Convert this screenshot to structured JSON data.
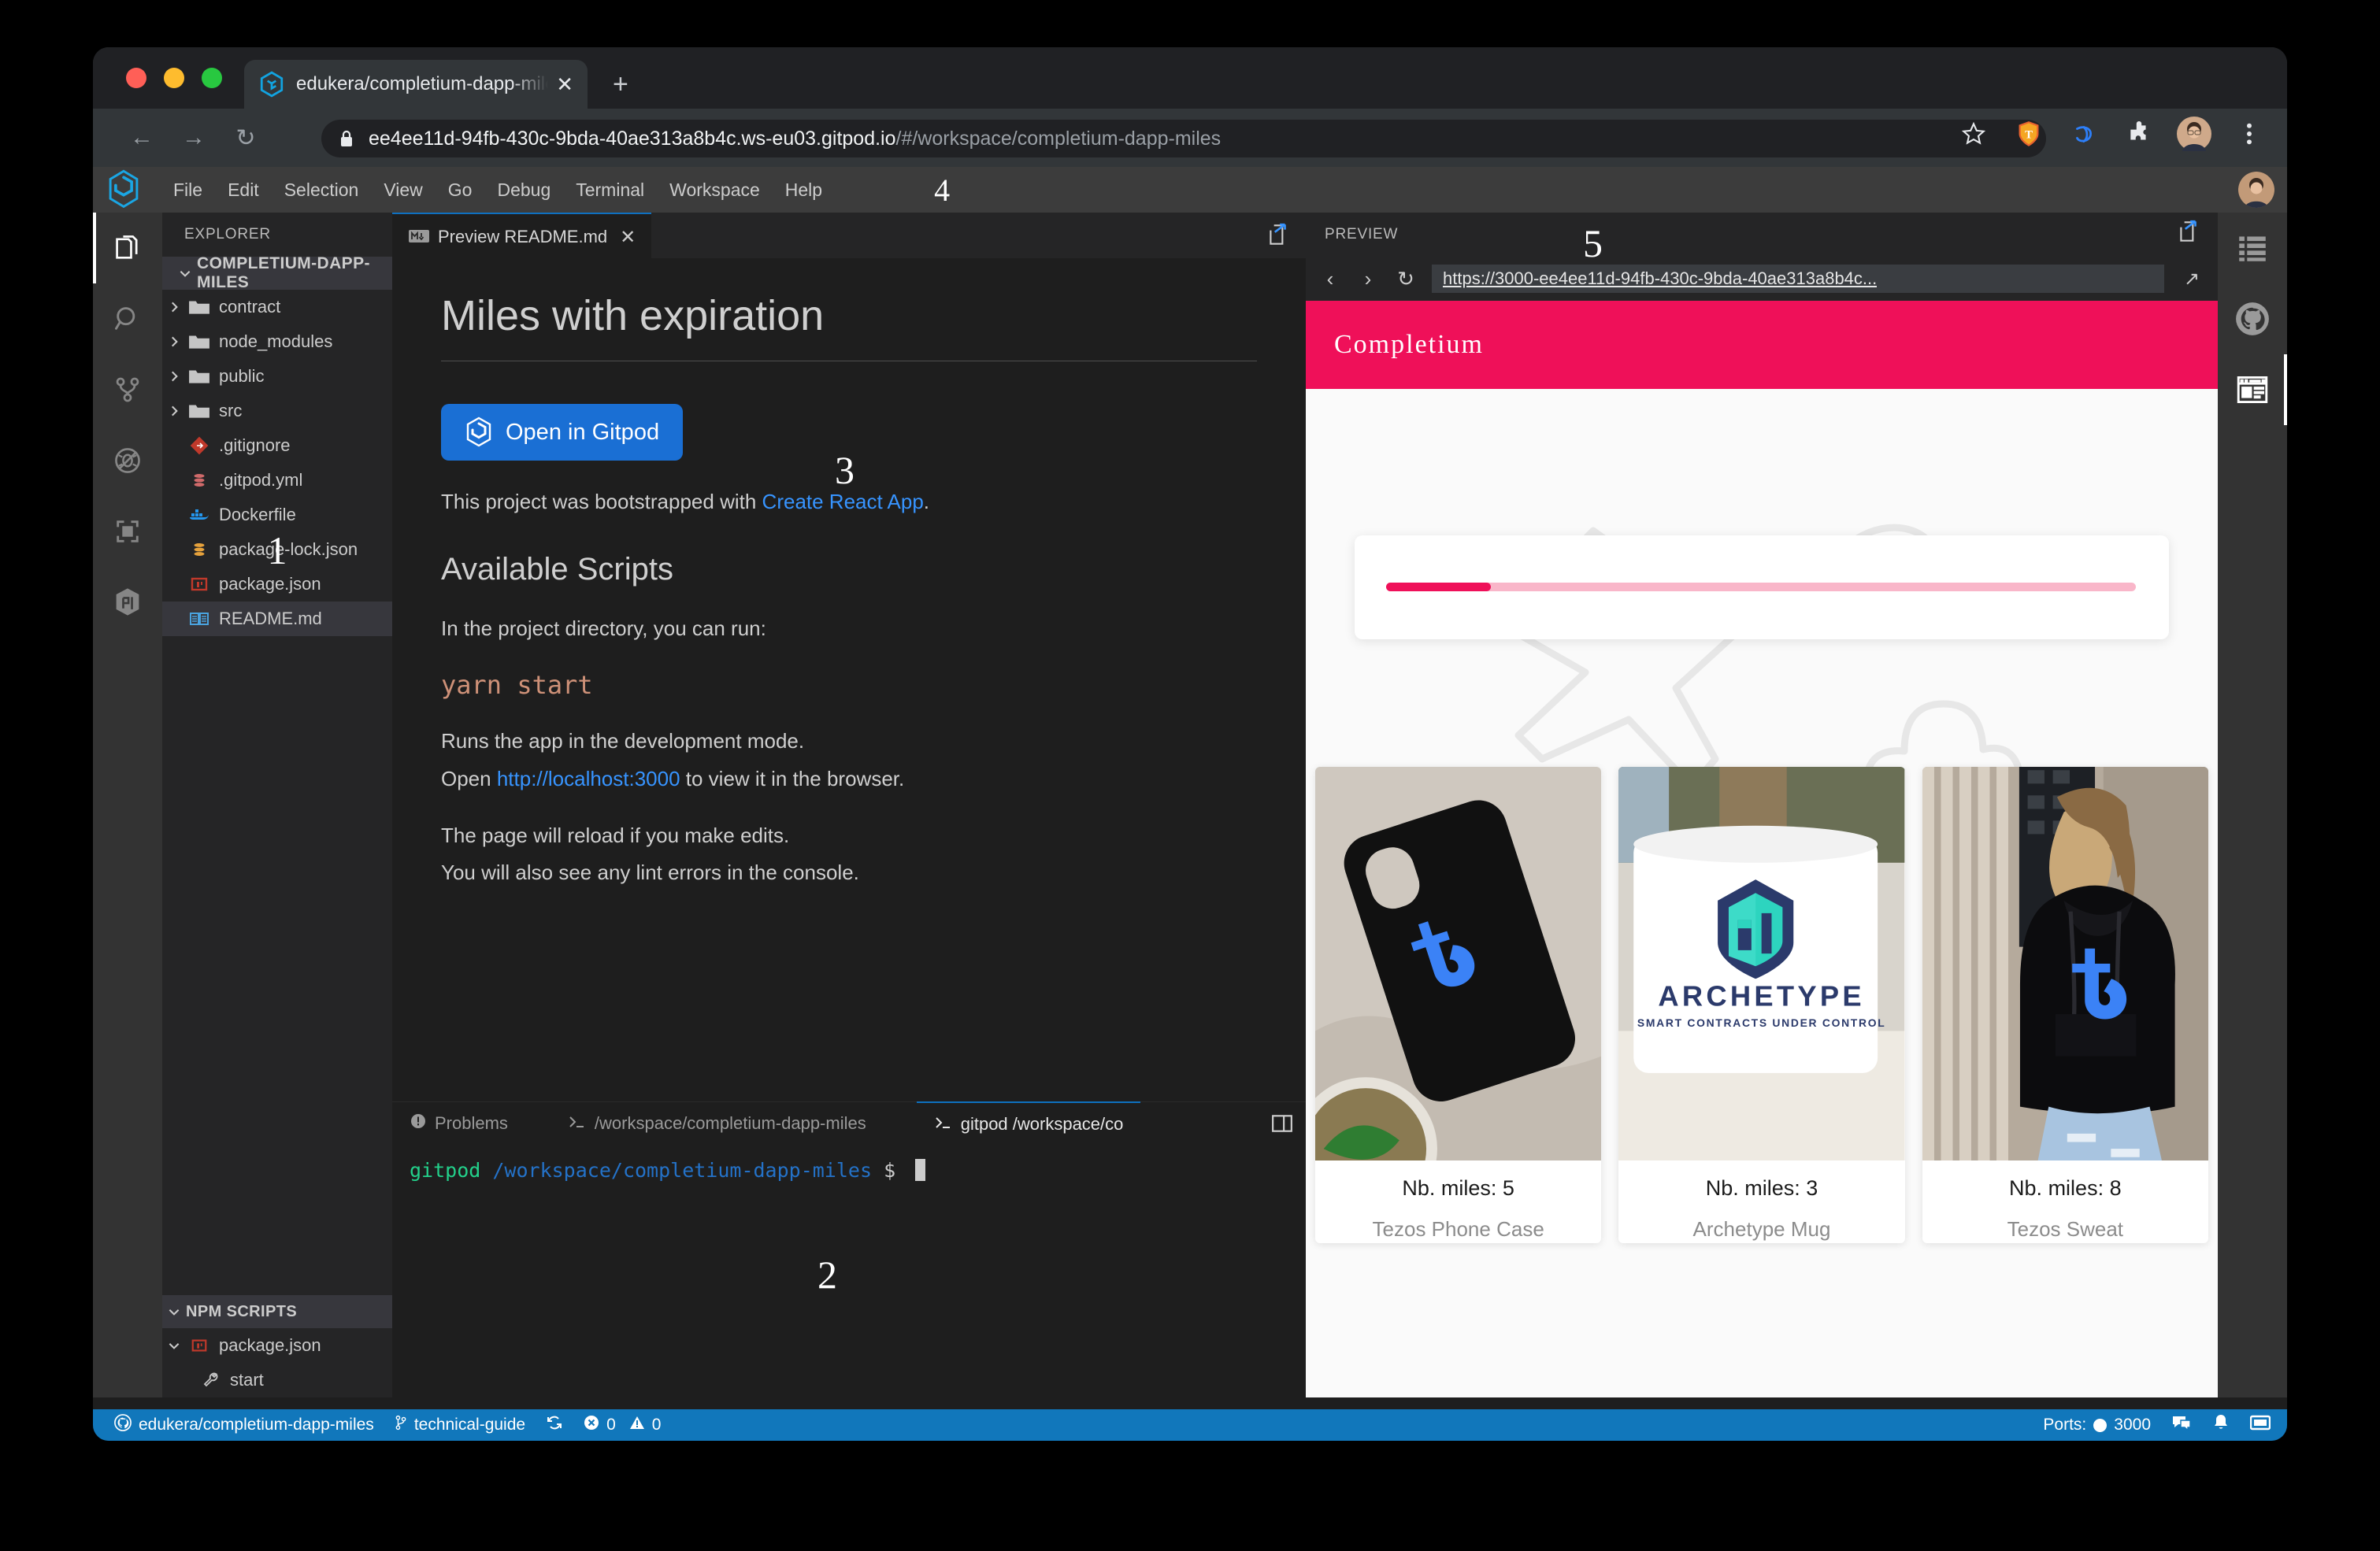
{
  "browser": {
    "tab": {
      "title": "edukera/completium-dapp-miles",
      "favicon": "gitpod-icon",
      "close": "✕"
    },
    "new_tab_label": "+",
    "nav": {
      "back": "←",
      "forward": "→",
      "reload": "↻"
    },
    "url_host": "ee4ee11d-94fb-430c-9bda-40ae313a8b4c.ws-eu03.gitpod.io",
    "url_path": "/#/workspace/completium-dapp-miles",
    "toolbar_icons": [
      "bookmark-star-icon",
      "shield-icon",
      "extension-blue-icon",
      "puzzle-extensions-icon",
      "profile-avatar",
      "chrome-menu-icon"
    ]
  },
  "ide": {
    "menu": [
      "File",
      "Edit",
      "Selection",
      "View",
      "Go",
      "Debug",
      "Terminal",
      "Workspace",
      "Help"
    ],
    "overlay_numbers": {
      "explorer": "1",
      "terminal": "2",
      "readme": "3",
      "menubar": "4",
      "preview": "5"
    },
    "activity_left": [
      "explorer-files-icon",
      "search-icon",
      "source-control-icon",
      "run-debug-icon",
      "remote-explorer-icon",
      "archetype-cube-icon"
    ],
    "activity_right": [
      "outline-list-icon",
      "github-icon",
      "open-preview-icon"
    ],
    "explorer": {
      "title": "EXPLORER",
      "root": "COMPLETIUM-DAPP-MILES",
      "items": [
        {
          "label": "contract",
          "type": "folder",
          "icon": "folder-icon",
          "expanded": false
        },
        {
          "label": "node_modules",
          "type": "folder",
          "icon": "folder-icon",
          "expanded": false
        },
        {
          "label": "public",
          "type": "folder",
          "icon": "folder-icon",
          "expanded": false
        },
        {
          "label": "src",
          "type": "folder",
          "icon": "folder-icon",
          "expanded": false
        },
        {
          "label": ".gitignore",
          "type": "file",
          "icon": "git-icon"
        },
        {
          "label": ".gitpod.yml",
          "type": "file",
          "icon": "yaml-icon"
        },
        {
          "label": "Dockerfile",
          "type": "file",
          "icon": "docker-icon"
        },
        {
          "label": "package-lock.json",
          "type": "file",
          "icon": "json-lock-icon"
        },
        {
          "label": "package.json",
          "type": "file",
          "icon": "npm-icon"
        },
        {
          "label": "README.md",
          "type": "file",
          "icon": "readme-book-icon",
          "selected": true
        }
      ],
      "npm_scripts": {
        "title": "NPM SCRIPTS",
        "package": "package.json",
        "scripts": [
          "start"
        ]
      }
    },
    "editor": {
      "tab": {
        "label": "Preview README.md",
        "icon": "markdown-icon",
        "close": "✕"
      },
      "action_icon": "split-editor-icon",
      "readme": {
        "h1": "Miles with expiration",
        "gitpod_button": "Open in Gitpod",
        "intro_before": "This project was bootstrapped with ",
        "intro_link": "Create React App",
        "intro_after": ".",
        "h2": "Available Scripts",
        "p1": "In the project directory, you can run:",
        "code": "yarn start",
        "p2": "Runs the app in the development mode.",
        "p3_before": "Open ",
        "p3_link": "http://localhost:3000",
        "p3_after": " to view it in the browser.",
        "p4": "The page will reload if you make edits.",
        "p5": "You will also see any lint errors in the console."
      }
    },
    "panel": {
      "tabs": [
        {
          "label": "Problems",
          "icon": "problems-icon",
          "active": false
        },
        {
          "label": "/workspace/completium-dapp-miles",
          "icon": "terminal-icon",
          "active": false
        },
        {
          "label": "gitpod /workspace/co",
          "icon": "terminal-icon",
          "active": true
        }
      ],
      "split_icon": "split-terminal-icon",
      "terminal": {
        "user": "gitpod",
        "path": "/workspace/completium-dapp-miles",
        "prompt": "$"
      }
    },
    "preview": {
      "title": "PREVIEW",
      "action_icon": "open-in-browser-icon",
      "nav": {
        "back": "‹",
        "forward": "›",
        "reload": "↻",
        "external": "↗"
      },
      "url": "https://3000-ee4ee11d-94fb-430c-9bda-40ae313a8b4c...",
      "app": {
        "brand": "Completium",
        "brand_color": "#ef1059",
        "progress_percent": 14,
        "products": [
          {
            "miles": "Nb. miles: 5",
            "name": "Tezos Phone Case",
            "image": "tezos-phone-case-photo"
          },
          {
            "miles": "Nb. miles: 3",
            "name": "Archetype Mug",
            "image": "archetype-mug-photo"
          },
          {
            "miles": "Nb. miles: 8",
            "name": "Tezos Sweat",
            "image": "tezos-sweatshirt-photo"
          }
        ]
      }
    },
    "statusbar": {
      "repo_icon": "github-icon",
      "repo": "edukera/completium-dapp-miles",
      "branch_icon": "branch-icon",
      "branch": "technical-guide",
      "sync_icon": "sync-icon",
      "errors": "0",
      "warnings": "0",
      "ports_label": "Ports:",
      "ports_value": "3000",
      "feedback_icon": "feedback-icon",
      "bell_icon": "bell-icon",
      "layout_icon": "layout-icon"
    }
  }
}
